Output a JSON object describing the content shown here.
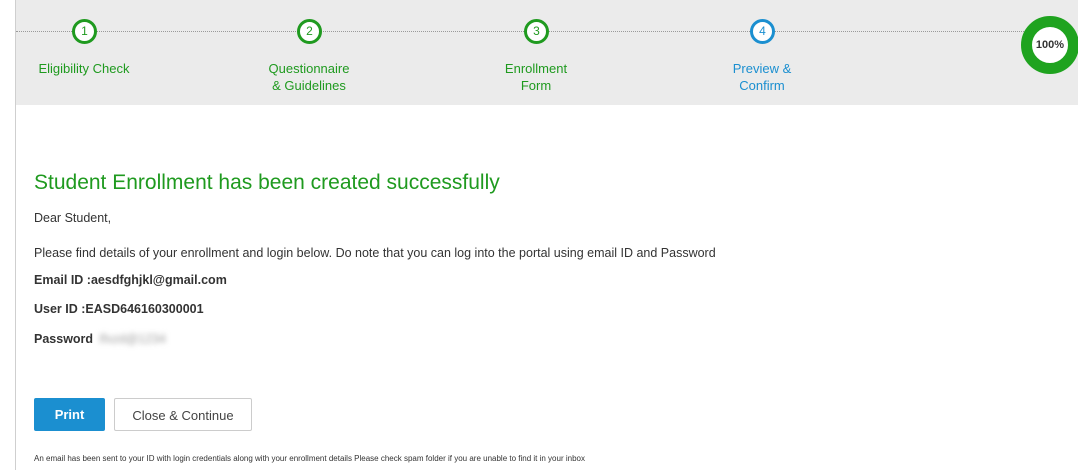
{
  "stepper": {
    "steps": [
      {
        "number": "1",
        "label_line1": "Eligibility Check",
        "label_line2": ""
      },
      {
        "number": "2",
        "label_line1": "Questionnaire",
        "label_line2": "& Guidelines"
      },
      {
        "number": "3",
        "label_line1": "Enrollment",
        "label_line2": "Form"
      },
      {
        "number": "4",
        "label_line1": "Preview &",
        "label_line2": "Confirm"
      }
    ],
    "progress_label": "100%",
    "progress_value": 1.0,
    "colors": {
      "done": "#1f9a1f",
      "active": "#1b8fd0"
    }
  },
  "confirmation": {
    "title": "Student Enrollment has been created successfully",
    "greeting": "Dear Student,",
    "message": "Please find details of your enrollment and login below. Do note that you can log into the portal using email ID and Password",
    "email_label": "Email ID :",
    "email_value": "aesdfghjkl@gmail.com",
    "userid_label": "User ID :",
    "userid_value": "EASD646160300001",
    "password_label": "Password",
    "password_value": "Ifxzd@1234"
  },
  "actions": {
    "print_label": "Print",
    "close_label": "Close & Continue"
  },
  "footnote": "An email has been sent to your ID with login credentials along with your enrollment details Please check spam folder if you are unable to find it in your inbox"
}
